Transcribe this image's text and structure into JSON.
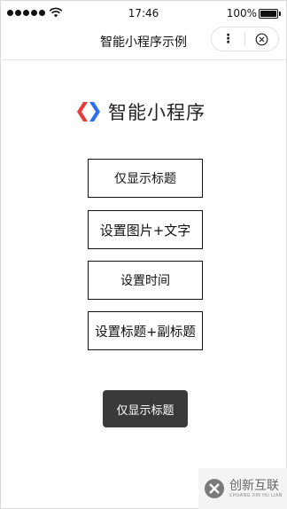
{
  "status_bar": {
    "time": "17:46",
    "battery_percent": "100%",
    "battery_level": 1.0,
    "signal_bars": 5
  },
  "nav": {
    "title": "智能小程序示例",
    "more_icon": "more-icon",
    "close_icon": "close-circle-icon"
  },
  "logo": {
    "text": "智能小程序",
    "colors": {
      "red": "#e63a3a",
      "blue": "#2f6df0"
    }
  },
  "buttons": [
    {
      "label": "仅显示标题"
    },
    {
      "label": "设置图片+文字"
    },
    {
      "label": "设置时间"
    },
    {
      "label": "设置标题+副标题"
    }
  ],
  "toast": {
    "text": "仅显示标题"
  },
  "watermark": {
    "name": "创新互联",
    "sub": "CHUANG XIN HU LIAN"
  }
}
